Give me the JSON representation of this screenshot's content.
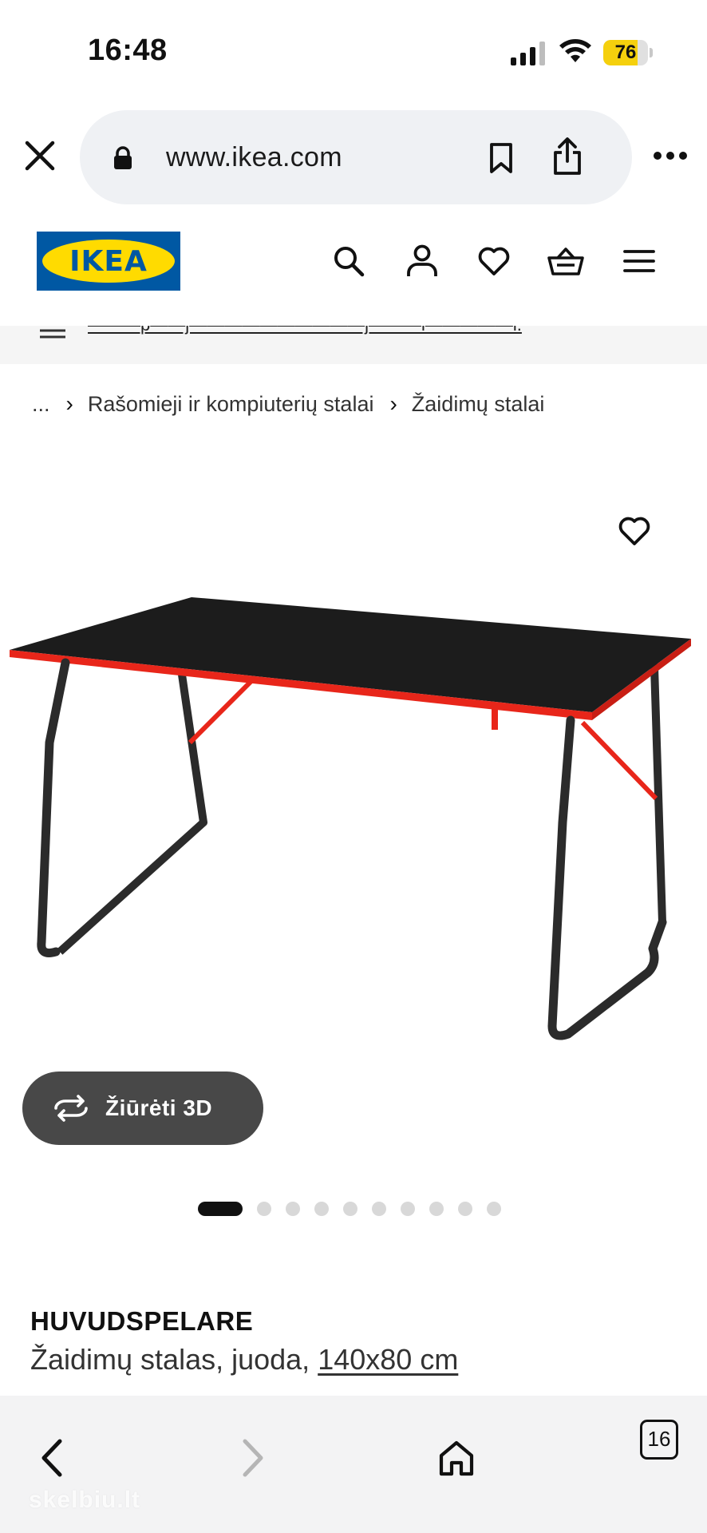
{
  "status_bar": {
    "time": "16:48",
    "battery_percent": "76",
    "battery_level": 0.76,
    "icons": [
      "cellular-signal-icon",
      "wifi-icon",
      "battery-icon"
    ]
  },
  "browser": {
    "url": "www.ikea.com",
    "icons": [
      "close-icon",
      "lock-icon",
      "bookmark-icon",
      "share-icon",
      "more-icon"
    ]
  },
  "header": {
    "logo_text": "IKEA",
    "icons": [
      "search-icon",
      "account-icon",
      "heart-icon",
      "cart-icon",
      "menu-icon"
    ]
  },
  "info_strip": {
    "text": "———p——j——————————j———i—————i."
  },
  "breadcrumb": {
    "ellipsis": "...",
    "separator": "›",
    "items": [
      "Rašomieji ir kompiuterių stalai",
      "Žaidimų stalai"
    ]
  },
  "product": {
    "view_3d_label": "Žiūrėti 3D",
    "image_count": 10,
    "active_image_index": 0,
    "name": "HUVUDSPELARE",
    "description": "Žaidimų stalas, juoda,",
    "size": "140x80 cm"
  },
  "bottom_nav": {
    "tabs_count": "16",
    "icons": [
      "back-icon",
      "forward-icon",
      "home-icon",
      "tabs-icon"
    ]
  },
  "watermark": "skelbiu.lt",
  "colors": {
    "ikea_blue": "#0058a3",
    "ikea_yellow": "#ffdb00",
    "desk_top": "#1c1c1c",
    "desk_edge": "#e8261a",
    "button_bg": "#484848"
  }
}
